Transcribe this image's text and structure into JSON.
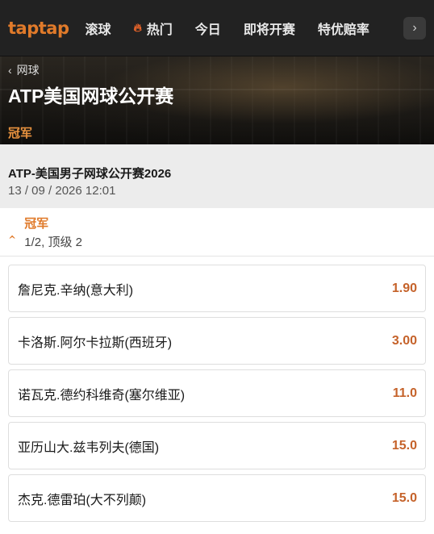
{
  "nav": {
    "logo": "taptap",
    "items": [
      {
        "label": "滚球",
        "icon": ""
      },
      {
        "label": "热门",
        "icon": "flame-icon"
      },
      {
        "label": "今日",
        "icon": ""
      },
      {
        "label": "即将开赛",
        "icon": ""
      },
      {
        "label": "特优赔率",
        "icon": ""
      }
    ],
    "more_icon": "chevron-right-icon"
  },
  "hero": {
    "breadcrumb": "网球",
    "title": "ATP美国网球公开赛",
    "subtitle": "冠军"
  },
  "event": {
    "name": "ATP-美国男子网球公开赛2026",
    "datetime": "13 / 09 / 2026 12:01"
  },
  "market": {
    "title": "冠军",
    "description": "1/2, 顶级 2"
  },
  "selections": [
    {
      "name": "詹尼克.辛纳(意大利)",
      "odds": "1.90"
    },
    {
      "name": "卡洛斯.阿尔卡拉斯(西班牙)",
      "odds": "3.00"
    },
    {
      "name": "诺瓦克.德约科维奇(塞尔维亚)",
      "odds": "11.0"
    },
    {
      "name": "亚历山大.兹韦列夫(德国)",
      "odds": "15.0"
    },
    {
      "name": "杰克.德雷珀(大不列颠)",
      "odds": "15.0"
    }
  ],
  "colors": {
    "accent": "#e07a2a",
    "odds": "#c5622a",
    "nav_bg": "#222222"
  }
}
